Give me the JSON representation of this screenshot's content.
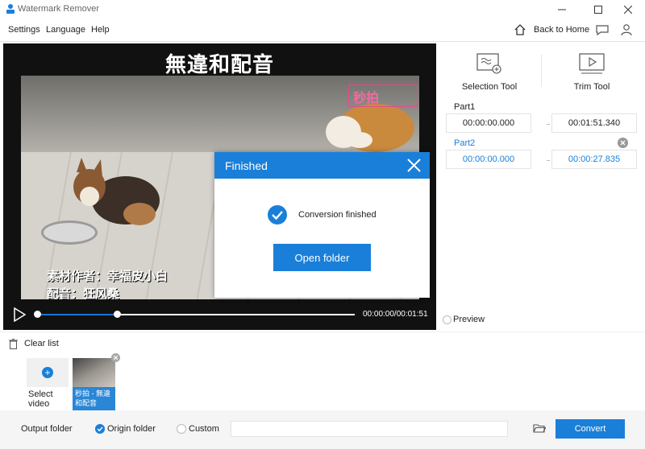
{
  "window": {
    "title": "Watermark Remover"
  },
  "menu": {
    "settings": "Settings",
    "language": "Language",
    "help": "Help",
    "back_home": "Back to Home"
  },
  "video": {
    "title_text": "無違和配音",
    "watermark_text": "秒拍",
    "caption_author": "素材作者：幸福皮小白",
    "caption_dub": "配音：狂风桑",
    "time": "00:00:00/00:01:51",
    "progress": 0.25
  },
  "dialog": {
    "title": "Finished",
    "message": "Conversion finished",
    "button": "Open folder"
  },
  "tools": {
    "selection": "Selection Tool",
    "trim": "Trim Tool"
  },
  "parts": [
    {
      "label": "Part1",
      "start": "00:00:00.000",
      "end": "00:01:51.340",
      "color": "#222222"
    },
    {
      "label": "Part2",
      "start": "00:00:00.000",
      "end": "00:00:27.835",
      "color": "#1a7fd9"
    }
  ],
  "preview_label": "Preview",
  "list": {
    "clear": "Clear list",
    "select_video": "Select video",
    "item_name": "秒拍 - 無違和配音"
  },
  "bottom": {
    "output_folder": "Output folder",
    "origin_folder": "Origin folder",
    "custom": "Custom",
    "convert": "Convert",
    "path_value": ""
  },
  "colors": {
    "accent": "#1a7fd9"
  }
}
